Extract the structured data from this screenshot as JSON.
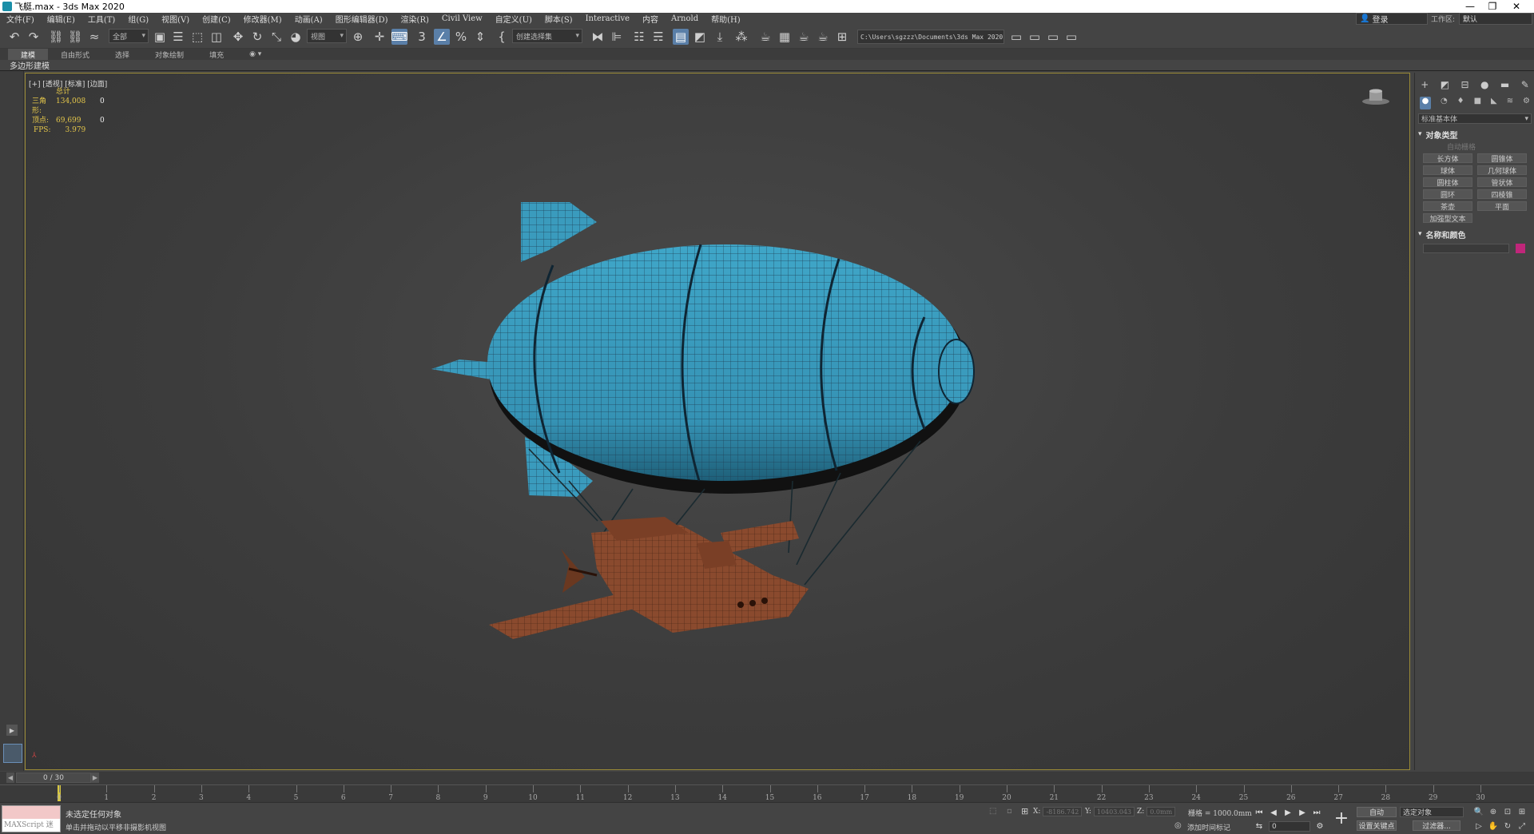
{
  "window": {
    "title": "飞艇.max - 3ds Max 2020",
    "minimize": "—",
    "maximize": "❐",
    "close": "✕"
  },
  "menu": [
    "文件(F)",
    "编辑(E)",
    "工具(T)",
    "组(G)",
    "视图(V)",
    "创建(C)",
    "修改器(M)",
    "动画(A)",
    "图形编辑器(D)",
    "渲染(R)",
    "Civil View",
    "自定义(U)",
    "脚本(S)",
    "Interactive",
    "内容",
    "Arnold",
    "帮助(H)"
  ],
  "account": {
    "signin": "登录",
    "workspace_label": "工作区:",
    "workspace_value": "默认"
  },
  "toolbar": {
    "selection_filter": "全部",
    "ref_coord": "视图",
    "named_selection": "创建选择集",
    "project_path": "C:\\Users\\sgzzz\\Documents\\3ds Max 2020"
  },
  "ribbon": {
    "tabs": [
      "建模",
      "自由形式",
      "选择",
      "对象绘制",
      "填充"
    ],
    "active_tab": "建模",
    "sub_label": "多边形建模"
  },
  "viewport": {
    "label": "[+] [透视] [标准] [边面]",
    "stats_header": "总计",
    "stats": [
      {
        "label": "三角形:",
        "value": "134,008",
        "sel": "0"
      },
      {
        "label": "顶点:",
        "value": "69,699",
        "sel": "0"
      }
    ],
    "fps_label": "FPS:",
    "fps_value": "3.979",
    "balloon_color": "#3a9bbd",
    "ship_color": "#8a4a2e"
  },
  "command_panel": {
    "category": "标准基本体",
    "object_type_title": "对象类型",
    "autogrid": "自动栅格",
    "buttons": [
      "长方体",
      "圆锥体",
      "球体",
      "几何球体",
      "圆柱体",
      "管状体",
      "圆环",
      "四棱锥",
      "茶壶",
      "平面",
      "加强型文本"
    ],
    "name_color_title": "名称和颜色",
    "object_color": "#c0267a"
  },
  "timeline": {
    "frame_display": "0 / 30",
    "ticks": [
      "0",
      "1",
      "2",
      "3",
      "4",
      "5",
      "6",
      "7",
      "8",
      "9",
      "10",
      "11",
      "12",
      "13",
      "14",
      "15",
      "16",
      "17",
      "18",
      "19",
      "20",
      "21",
      "22",
      "23",
      "24",
      "25",
      "26",
      "27",
      "28",
      "29",
      "30"
    ]
  },
  "status": {
    "maxscript_label": "MAXScript 迷",
    "line1": "未选定任何对象",
    "line2": "单击并拖动以平移非摄影机视图",
    "x_label": "X:",
    "x_value": "-8186.742",
    "y_label": "Y:",
    "y_value": "10403.043",
    "z_label": "Z:",
    "z_value": "0.0mm",
    "grid": "栅格 = 1000.0mm",
    "add_time_tag": "添加时间标记",
    "auto_key": "自动",
    "selection_set": "选定对象",
    "set_key": "设置关键点",
    "filters": "过滤器...",
    "current_frame": "0"
  }
}
